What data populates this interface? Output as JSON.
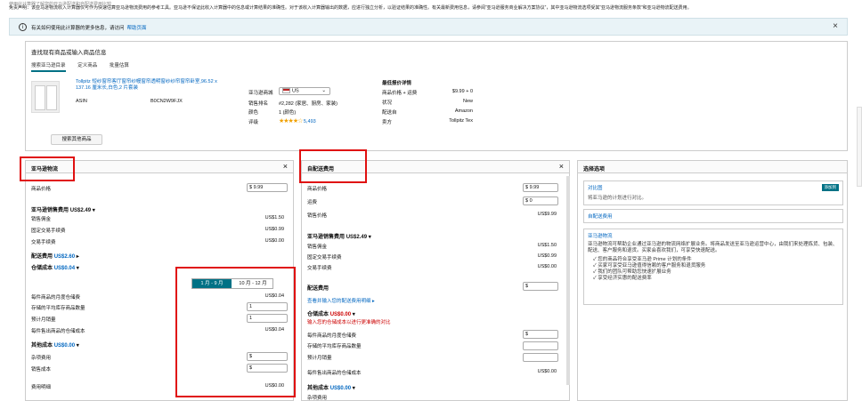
{
  "top_fragment": "使用此计算器了解您的亚马逊配送和自配送费用比较",
  "disclaimer": "免责声明：该亚马逊物流收入计算器仅可作为快速估算亚马逊物流费用的参考工具。亚马逊不保证此收入计算器中的信息或计算结果的准确性。对于该收入计算器输出的数据，应进行独立分析，以验证结果的准确性。有关最新费用信息，请参阅“亚马逊服务商业解决方案协议”，其中亚马逊物流选项受其“亚马逊物流服务条款”和亚马逊物流配送费用。",
  "notice": {
    "text": "有关如何使用此计算器的更多信息，请访问",
    "link": "帮助页面"
  },
  "find": {
    "title": "查找现有商品或输入商品信息",
    "tabs": [
      "搜索亚马逊目录",
      "定义商品",
      "批量估算"
    ],
    "product": {
      "title": "Tollpitz 短纱窗帘客厅窗帘纱幔窗帘透明窗纱纱帘窗帘卧室,96.52 x 137.16 厘米长,白色,2 片套装",
      "asin_label": "ASIN",
      "asin": "B0CN2W9FJX",
      "marketplace_label": "亚马逊商城",
      "marketplace": "US",
      "rank_label": "销售排名",
      "rank": "#2,282 (家居、厨房、家装)",
      "variants_label": "颜色",
      "variants": "1 (颜色)",
      "rating_label": "评级",
      "rating_count": "5,493",
      "stars": "★★★★☆"
    },
    "lowest": {
      "title": "最低报价详情",
      "price_label": "商品价格 + 运费",
      "price": "$9.99 + 0",
      "condition_label": "状况",
      "condition": "New",
      "ship_label": "配送自",
      "ship": "Amazon",
      "seller_label": "卖方",
      "seller": "Tollpitz Tex"
    },
    "other_button": "搜索其他商品"
  },
  "fba": {
    "title": "亚马逊物流",
    "price_label": "商品价格",
    "price": "9.99",
    "fees_title": "亚马逊销售费用",
    "fees_total": "US$2.49",
    "referral_label": "销售佣金",
    "referral": "US$1.50",
    "fixed_label": "固定交易手续费",
    "fixed": "US$0.99",
    "variable_label": "交易手续费",
    "variable": "US$0.00",
    "ship_title": "配送费用",
    "ship_total": "US$2.60",
    "storage_title": "仓储成本",
    "storage_total": "US$0.04",
    "season_a": "1 月 - 9 月",
    "season_b": "10 月 - 12 月",
    "monthly_label": "每件商品的月度仓储费",
    "monthly": "US$0.04",
    "avg_inv_label": "存储的平均库存商品数量",
    "avg_inv": "1",
    "units_label": "预计月销量",
    "units": "1",
    "per_unit_label": "每件售出商品的仓储成本",
    "per_unit": "US$0.04",
    "other_title": "其他成本",
    "other_total": "US$0.00",
    "misc_label": "杂项费用",
    "cost_label": "销售成本",
    "misc_fee_label": "费用明细",
    "misc_fee": "US$0.00"
  },
  "mfn": {
    "title": "自配送费用",
    "price_label": "商品价格",
    "price": "9.99",
    "shipping_label": "运费",
    "shipping": "0",
    "total_label": "销售价格",
    "total": "US$9.99",
    "fees_title": "亚马逊销售费用",
    "fees_total": "US$2.49",
    "referral_label": "销售佣金",
    "referral": "US$1.50",
    "fixed_label": "固定交易手续费",
    "fixed": "US$0.99",
    "variable_label": "交易手续费",
    "variable": "US$0.00",
    "ship_title": "配送费用",
    "ship_link": "查看并输入您的配送费用明细",
    "storage_title": "仓储成本",
    "storage_total": "US$0.00",
    "storage_warn": "输入您的仓储成本以进行更准确的对比",
    "monthly_label": "每件商品的月度仓储费",
    "avg_inv_label": "存储的平均库存商品数量",
    "units_label": "预计月销量",
    "per_unit_label": "每件售出商品的仓储成本",
    "per_unit": "US$0.00",
    "other_title": "其他成本",
    "other_total": "US$0.00",
    "misc_label": "杂项费用"
  },
  "options": {
    "title": "选择选项",
    "compare_label": "对比图",
    "compare_badge": "添加到",
    "compare_desc": "将亚马逊的计划进行对比。",
    "mfn_label": "自配送费用",
    "fba_label": "亚马逊物流",
    "fba_desc": "亚马逊物流可帮助企业通过亚马逊的物流网络扩展业务。将商品发送至亚马逊运营中心，由我们来处理拣货、包装、配送、客户服务和退货。买家会喜欢我们，可享受快速配送。",
    "bullets": [
      "您的商品符合享受亚马逊 Prime 计划的条件",
      "买家可享受亚马逊值得信赖的客户服务和退货服务",
      "我们的团队可帮助您快速扩展业务",
      "享受经济实惠的配送费率"
    ]
  }
}
